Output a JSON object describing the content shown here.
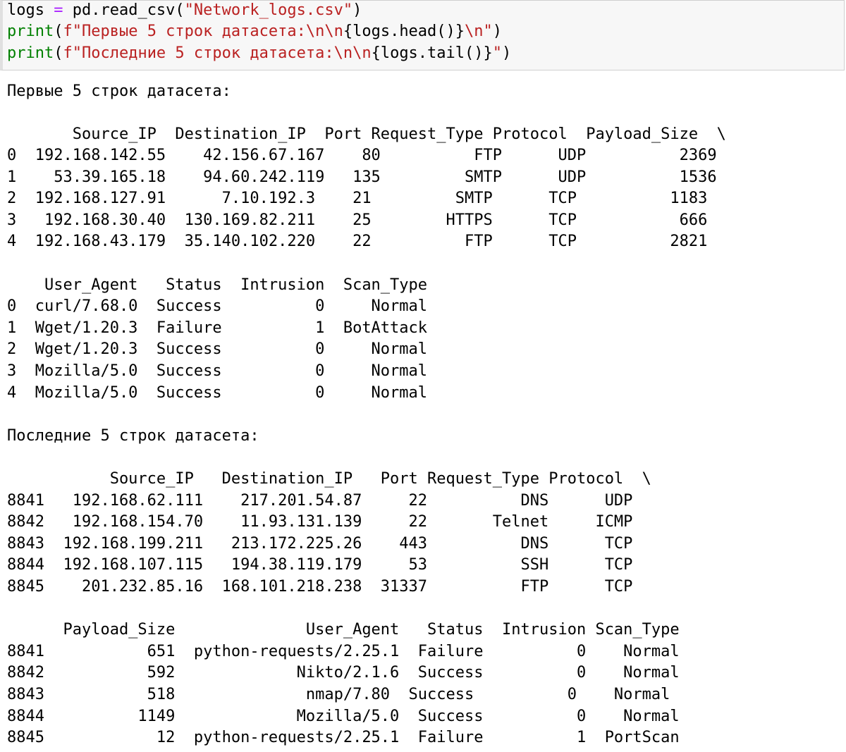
{
  "cell": {
    "code": [
      [
        {
          "t": "logs ",
          "c": "plain"
        },
        {
          "t": "=",
          "c": "op"
        },
        {
          "t": " pd.read_csv(",
          "c": "plain"
        },
        {
          "t": "\"Network_logs.csv\"",
          "c": "str"
        },
        {
          "t": ")",
          "c": "plain"
        }
      ],
      [
        {
          "t": "print",
          "c": "kw"
        },
        {
          "t": "(",
          "c": "plain"
        },
        {
          "t": "f\"Первые 5 строк датасета:\\n\\n",
          "c": "str"
        },
        {
          "t": "{logs.head()}",
          "c": "plain"
        },
        {
          "t": "\\n\"",
          "c": "str"
        },
        {
          "t": ")",
          "c": "plain"
        }
      ],
      [
        {
          "t": "print",
          "c": "kw"
        },
        {
          "t": "(",
          "c": "plain"
        },
        {
          "t": "f\"Последние 5 строк датасета:\\n\\n",
          "c": "str"
        },
        {
          "t": "{logs.tail()}",
          "c": "plain"
        },
        {
          "t": "\"",
          "c": "str"
        },
        {
          "t": ")",
          "c": "plain"
        }
      ]
    ]
  },
  "output": {
    "head_title": "Первые 5 строк датасета:",
    "head_table1": {
      "header": "       Source_IP  Destination_IP  Port Request_Type Protocol  Payload_Size  \\",
      "rows": [
        "0  192.168.142.55    42.156.67.167    80          FTP      UDP          2369",
        "1    53.39.165.18    94.60.242.119   135         SMTP      UDP          1536",
        "2  192.168.127.91      7.10.192.3    21         SMTP      TCP          1183",
        "3   192.168.30.40  130.169.82.211    25        HTTPS      TCP           666",
        "4  192.168.43.179  35.140.102.220    22          FTP      TCP          2821"
      ]
    },
    "head_table2": {
      "header": "    User_Agent   Status  Intrusion  Scan_Type",
      "rows": [
        "0  curl/7.68.0  Success          0     Normal",
        "1  Wget/1.20.3  Failure          1  BotAttack",
        "2  Wget/1.20.3  Success          0     Normal",
        "3  Mozilla/5.0  Success          0     Normal",
        "4  Mozilla/5.0  Success          0     Normal"
      ]
    },
    "tail_title": "Последние 5 строк датасета:",
    "tail_table1": {
      "header": "           Source_IP   Destination_IP   Port Request_Type Protocol  \\",
      "rows": [
        "8841   192.168.62.111    217.201.54.87     22          DNS      UDP",
        "8842   192.168.154.70    11.93.131.139     22       Telnet     ICMP",
        "8843  192.168.199.211   213.172.225.26    443          DNS      TCP",
        "8844  192.168.107.115   194.38.119.179     53          SSH      TCP",
        "8845    201.232.85.16  168.101.218.238  31337          FTP      TCP"
      ]
    },
    "tail_table2": {
      "header": "      Payload_Size              User_Agent   Status  Intrusion Scan_Type",
      "rows": [
        "8841           651  python-requests/2.25.1  Failure          0    Normal",
        "8842           592             Nikto/2.1.6  Success          0    Normal",
        "8843           518              nmap/7.80  Success          0    Normal",
        "8844          1149             Mozilla/5.0  Success          0    Normal",
        "8845            12  python-requests/2.25.1  Failure          1  PortScan"
      ]
    }
  }
}
